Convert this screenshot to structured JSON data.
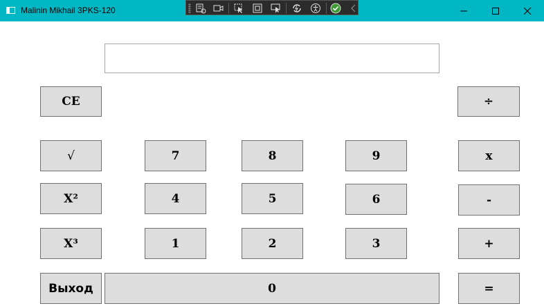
{
  "window": {
    "title": "Malinin Mikhail 3PKS-120",
    "accent_color": "#00b7c3",
    "controls": [
      "minimize-icon",
      "maximize-icon",
      "close-icon"
    ]
  },
  "debug_toolbar": {
    "icons": [
      "live-visual-tree-icon",
      "recording-icon",
      "select-element-icon",
      "display-layout-adorners-icon",
      "track-focused-element-icon",
      "hot-reload-icon",
      "accessibility-checker-icon",
      "binding-failures-ok-icon",
      "collapse-chevron-icon"
    ]
  },
  "display": {
    "value": ""
  },
  "keys": {
    "ce": "CE",
    "divide": "÷",
    "sqrt": "√",
    "seven": "7",
    "eight": "8",
    "nine": "9",
    "multiply": "x",
    "square": "X²",
    "four": "4",
    "five": "5",
    "six": "6",
    "minus": "-",
    "cube": "X³",
    "one": "1",
    "two": "2",
    "three": "3",
    "plus": "+",
    "exit": "Выход",
    "zero": "0",
    "equals": "="
  }
}
